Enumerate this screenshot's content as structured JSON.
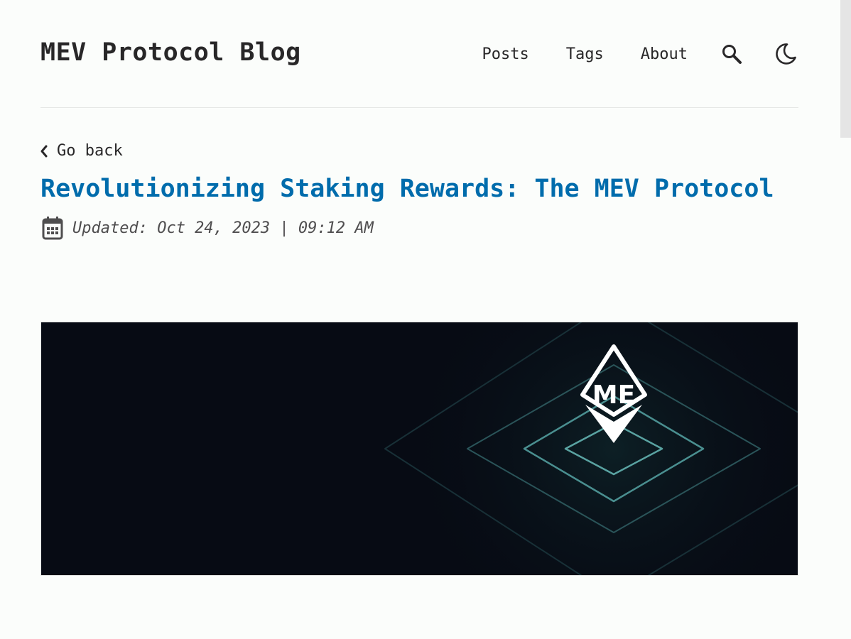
{
  "site": {
    "title": "MEV Protocol Blog"
  },
  "nav": {
    "items": [
      {
        "label": "Posts"
      },
      {
        "label": "Tags"
      },
      {
        "label": "About"
      }
    ],
    "search_icon": "search-icon",
    "theme_icon": "moon-icon"
  },
  "post": {
    "back_label": "Go back",
    "title": "Revolutionizing Staking Rewards: The MEV Protocol",
    "date_text": "Updated: Oct 24, 2023 | 09:12 AM",
    "hero": {
      "logo_letters": "ME"
    }
  },
  "colors": {
    "background": "#fbfdfb",
    "text": "#282728",
    "accent": "#006cac",
    "hero_background": "#070b14",
    "hero_lines": "#4a8f90"
  }
}
